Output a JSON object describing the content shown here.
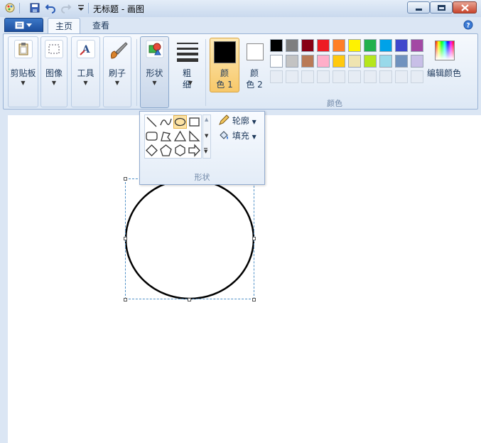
{
  "window": {
    "title": "无标题 - 画图",
    "controls": [
      "minimize",
      "maximize",
      "close"
    ]
  },
  "tabs": {
    "file_label": "",
    "items": [
      "主页",
      "查看"
    ],
    "active": "主页"
  },
  "ribbon": {
    "clipboard": "剪贴板",
    "image": "图像",
    "tools": "工具",
    "brushes": "刷子",
    "shapes": "形状",
    "size_top": "粗",
    "size_bottom": "细",
    "color1_top": "颜",
    "color1_bottom": "色 1",
    "color2_top": "颜",
    "color2_bottom": "色 2",
    "edit_colors": "编辑颜色",
    "colors_group": "颜色"
  },
  "palette": {
    "row1": [
      "#000000",
      "#7f7f7f",
      "#880015",
      "#ed1c24",
      "#ff7f27",
      "#fff200",
      "#22b14c",
      "#00a2e8",
      "#3f48cc",
      "#a349a4"
    ],
    "row2": [
      "#ffffff",
      "#c3c3c3",
      "#b97a57",
      "#ffaec9",
      "#ffc90e",
      "#efe4b0",
      "#b5e61d",
      "#99d9ea",
      "#7092be",
      "#c8bfe7"
    ],
    "row3_empty_count": 10,
    "color1": "#000000",
    "color2": "#ffffff"
  },
  "shapes_popup": {
    "outline": "轮廓",
    "fill": "填充",
    "caption": "形状",
    "selected_shape": "oval"
  },
  "canvas": {
    "shape": "ellipse",
    "stroke_color": "#000000"
  }
}
